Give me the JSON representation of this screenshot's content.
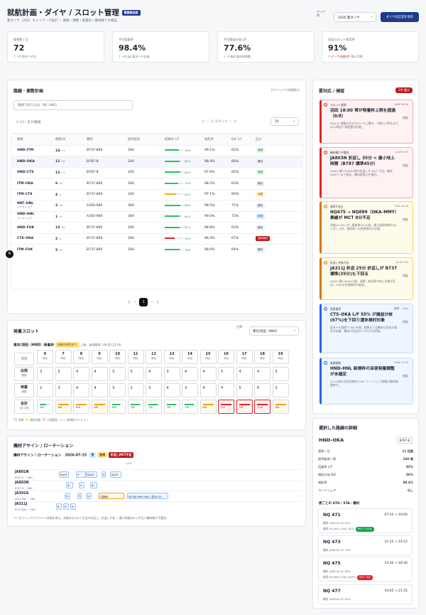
{
  "header": {
    "title": "就航計画・ダイヤ / スロット管理",
    "badge": "需要統括部",
    "subtitle": "夏ダイヤ（26S）ネットワーク設計 — 路線・便数 / 発着枠 / 機材繰りの検証",
    "season_label": "ダイヤ期",
    "season_value": "2026 夏ダイヤ",
    "save_button": "ダイヤ改正案を保存"
  },
  "kpis": [
    {
      "label": "総便数 / 日",
      "value": "72",
      "delta": "+2",
      "delta_text": "前ダイヤ比",
      "up": true
    },
    {
      "label": "平均搭乗率",
      "value": "98.4%",
      "delta": "+0.3pt",
      "delta_text": "夏ダイヤ計画",
      "up": true
    },
    {
      "label": "平均損益分岐 L/F",
      "value": "77.6%",
      "delta": "-0.8pt",
      "delta_text": "前年同時期",
      "up": false
    },
    {
      "label": "羽田スロット使用率",
      "value": "91%",
      "delta": "ピーク混雑2件",
      "delta_text": "06–21時",
      "up": false
    }
  ],
  "routes": {
    "title": "路線・便数計画",
    "hint": "行クリックで詳細表示",
    "filter_placeholder": "路線で絞り込み（例: HND）...",
    "count_text": "1–10 / 全10路線",
    "page_text": "1 / 1ページ",
    "page_size": "10",
    "columns": [
      "路線",
      "便数/日",
      "機材",
      "提供座席",
      "搭乗率 L/F",
      "就航率",
      "B/E L/F",
      "区分"
    ],
    "rows": [
      {
        "route": "HND–ITM",
        "sub": "",
        "freq": "14",
        "chg": "+1",
        "ac": "B737-800",
        "seats": "166",
        "lf": 78,
        "rate": "99.1%",
        "be": "62%",
        "cat": "増便",
        "cc": "g"
      },
      {
        "route": "HND–OKA",
        "sub": "",
        "freq": "11",
        "chg": "±0",
        "ac": "B787-8",
        "seats": "240",
        "lf": 82,
        "rate": "98.4%",
        "be": "66%",
        "cat": "確定",
        "cc": "n"
      },
      {
        "route": "HND–CTS",
        "sub": "",
        "freq": "12",
        "chg": "+1",
        "ac": "B787-8",
        "seats": "240",
        "lf": 84,
        "rate": "97.9%",
        "be": "65%",
        "cat": "増便",
        "cc": "g"
      },
      {
        "route": "ITM–OKA",
        "sub": "",
        "freq": "6",
        "chg": "±0",
        "ac": "B737-800",
        "seats": "166",
        "lf": 74,
        "rate": "98.2%",
        "be": "63%",
        "cat": "確定",
        "cc": "n"
      },
      {
        "route": "ITM–CTS",
        "sub": "",
        "freq": "4",
        "chg": "-1",
        "ac": "B737-800",
        "seats": "166",
        "lf": 61,
        "rate": "97.1%",
        "be": "66%",
        "cat": "減便",
        "cc": "y"
      },
      {
        "route": "NRT–HNL",
        "sub": "コードシェア",
        "freq": "2",
        "chg": "±0",
        "ac": "A350-900",
        "seats": "369",
        "lf": 86,
        "rate": "99.5%",
        "be": "71%",
        "cat": "確定",
        "cc": "n"
      },
      {
        "route": "HND–HNL",
        "sub": "コードシェア",
        "freq": "1",
        "chg": "+1",
        "ac": "A350-900",
        "seats": "369",
        "lf": 80,
        "rate": "99.0%",
        "be": "73%",
        "cat": "新規",
        "cc": "b"
      },
      {
        "route": "HND–FUK",
        "sub": "",
        "freq": "15",
        "chg": "±0",
        "ac": "B737-800",
        "seats": "166",
        "lf": 81,
        "rate": "98.8%",
        "be": "63%",
        "cat": "確定",
        "cc": "n"
      },
      {
        "route": "CTS–OKA",
        "sub": "",
        "freq": "2",
        "chg": "-1",
        "ac": "B737-800",
        "seats": "166",
        "lf": 55,
        "rate": "96.4%",
        "be": "67%",
        "cat": "運休検討",
        "cc": "r"
      },
      {
        "route": "ITM–FUK",
        "sub": "",
        "freq": "5",
        "chg": "±0",
        "ac": "B737-800",
        "seats": "166",
        "lf": 79,
        "rate": "98.0%",
        "be": "64%",
        "cat": "確定",
        "cc": "n"
      }
    ],
    "pager": "1"
  },
  "alerts": {
    "title": "要対応 / 検証",
    "badge": "2件 重大",
    "items": [
      {
        "type": "スロット超過",
        "time": "HND 18:00",
        "head": "羽田 18:00 帯が発着枠上限を超過（9/8）",
        "body": "NQ475 増便分がタカピークに集中。1便を17時台または19時台へ再配置が必要。",
        "btn": "対応",
        "kind": "r"
      },
      {
        "type": "機材繰り不整合",
        "time": "10:05 CTS",
        "head": "JA803N 折返し 35分 < 最小地上時間（B787 標準45分）",
        "body": "NQ621便→NQ624便の折返しが MCT 不足。後続 NQ473 まで波及。機材差替えを検討。",
        "btn": "対応",
        "kind": "r"
      },
      {
        "type": "接続不成立",
        "time": "OKA 16:30",
        "head": "NQ475 → NQ889（OKA–MMY）乗継が MCT 8分不足",
        "body": "到着18:30に対し乗継便18:50発。最小接続時間30分に対し-8分。後続便への振替案内が必要。",
        "btn": "対応",
        "kind": "y"
      },
      {
        "type": "折返し余裕不足",
        "time": "10:00 ITM",
        "head": "JA311J 折返 25分 折返しが B737 標準(35分)も下回る",
        "body": "NQ014便→NQ019便。清掃・給油等の地上作業が圧迫。10分の余裕確保を推奨。",
        "btn": "対応",
        "kind": "y"
      },
      {
        "type": "低搭乗率",
        "time": "週間・-12pt",
        "head": "CTS–OKA L/F 55% が損益分岐(67%)を下回り運休検討対象",
        "body": "夏ダイヤ週割で 8/E 未達。減便または機材小型化の検討が必要。機材小型化のいずれかを評価。",
        "btn": "対応",
        "kind": "b"
      },
      {
        "type": "新規就航",
        "time": "HND 21:55",
        "head": "HND–HNL 新規枠の深夜発着調整が未確定",
        "body": "21:55発の羽田深夜枠とHA コードシェア調整の最終調整待ち。",
        "btn": "対応",
        "kind": "b"
      }
    ]
  },
  "slots": {
    "title": "発着スロット",
    "airport_label": "空港",
    "airport_value": "東京/羽田（HND）",
    "airport_head": "東京/羽田（HND）発着枠",
    "badge": "発着枠制約あり",
    "limit_text": "上限：各時間帯 / 06:00–21:00",
    "hour_label": "時刻",
    "hours": [
      "6",
      "7",
      "8",
      "9",
      "10",
      "11",
      "12",
      "13",
      "14",
      "15",
      "16",
      "17",
      "18",
      "19"
    ],
    "hour_unit": "時台",
    "dep_label": "出発",
    "dep_sub": "便数",
    "dep": [
      "3",
      "5",
      "4",
      "4",
      "3",
      "5",
      "4",
      "3",
      "4",
      "4",
      "5",
      "4",
      "4",
      "5"
    ],
    "arr_label": "到着",
    "arr_sub": "便数",
    "arr": [
      "2",
      "3",
      "4",
      "4",
      "3",
      "2",
      "3",
      "4",
      "3",
      "4",
      "4",
      "5",
      "6",
      "3"
    ],
    "tot_label": "合計",
    "tot_sub": "枠/上限",
    "tot": [
      "5/8",
      "8/8",
      "8/8",
      "8/8",
      "6/8",
      "7/8",
      "7/8",
      "7/8",
      "7/8",
      "8/8",
      "9/8",
      "9/8",
      "10/8",
      "8/8"
    ],
    "legend": [
      "余裕",
      "満枠近接",
      "上限超過",
      "+1 = 新規枠プレビュー"
    ]
  },
  "rotation": {
    "title": "機材アサイン / ローテーション",
    "sub": "機材アサイン / ローテーション",
    "date": "2026-07-15",
    "b1": "便",
    "b2": "整備",
    "b3": "折返しMCT不足",
    "day": "7/15",
    "aircraft": [
      {
        "reg": "JA801N",
        "type": "B787-8 ・ HND"
      },
      {
        "reg": "JA803N",
        "type": "B787-8 ・ HND"
      },
      {
        "reg": "JA391A",
        "type": "A350-900 ・ HND"
      },
      {
        "reg": "JA311J",
        "type": "B737-800 ・ HND"
      }
    ],
    "note": "バーをクリックでフライト詳細を表示。赤囲みは MCT 不足の折返し。折返しが赤 = 最小時間(MCT)不足で機材繰り不整合。"
  },
  "detail": {
    "title": "選択した路線の詳細",
    "route": "HND–OKA",
    "ac": "B787-8",
    "rows": [
      [
        "便数 / 日",
        "11 往復"
      ],
      [
        "提供座席 / 便",
        "240 席"
      ],
      [
        "搭乗率 L/F",
        "82%"
      ],
      [
        "損益分岐 B/E",
        "66%"
      ],
      [
        "就航率",
        "98.4%"
      ],
      [
        "コードシェア",
        "なし"
      ]
    ],
    "flights_title": "便ごとの STD / STA・機材",
    "flights": [
      {
        "no": "NQ 471",
        "time": "07:10 → 10:00",
        "l1": "機材 JA801N   L/F 84%",
        "l2": "接続 NQ 881 (OKA–ISG)",
        "pill": "MCT +22分",
        "pc": "g"
      },
      {
        "no": "NQ 473",
        "time": "11:25 → 14:15",
        "l1": "機材 JA803N   L/F 79%",
        "l2": "",
        "pill": "",
        "pc": ""
      },
      {
        "no": "NQ 475",
        "time": "15:40 → 18:30",
        "l1": "機材 JA801N   L/F 88%",
        "l2": "接続 NQ 889 (OKA–MMY)",
        "pill": "MCT -8分",
        "pc": "r"
      },
      {
        "no": "NQ 477",
        "time": "19:05 → 21:55",
        "l1": "機材 JA805N   L/F 81%",
        "l2": "",
        "pill": "",
        "pc": ""
      }
    ]
  }
}
